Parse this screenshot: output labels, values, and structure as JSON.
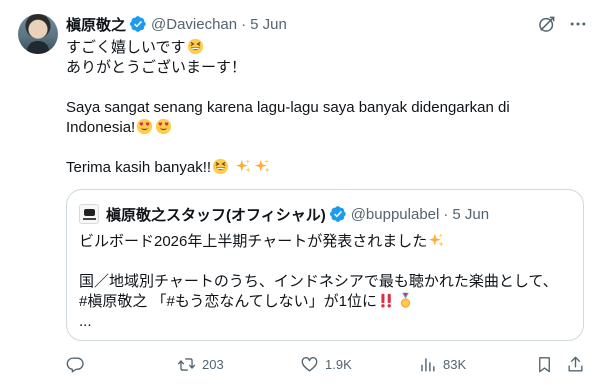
{
  "tweet": {
    "display_name": "槇原敬之",
    "handle": "@Daviechan",
    "separator": "·",
    "date": "5 Jun",
    "lines": {
      "l1": "すごく嬉しいです",
      "l2": "ありがとうございまーす！",
      "l3": "Saya sangat senang karena lagu-lagu saya banyak didengarkan di",
      "l4": "Indonesia!",
      "l5": "Terima kasih banyak!!"
    }
  },
  "quote": {
    "display_name": "槇原敬之スタッフ(オフィシャル)",
    "handle": "@buppulabel",
    "separator": "·",
    "date": "5 Jun",
    "lines": {
      "l1": "ビルボード2026年上半期チャートが発表されました",
      "l2": "国／地域別チャートのうち、インドネシアで最も聴かれた楽曲として、",
      "l3": "#槇原敬之 「#もう恋なんてしない」が1位に",
      "l4": "..."
    }
  },
  "actions": {
    "retweets": "203",
    "likes": "1.9K",
    "views": "83K"
  },
  "colors": {
    "verified": "#1d9bf0",
    "secondary_text": "#536471",
    "border": "#cfd9de"
  },
  "icons": [
    "verified-badge-icon",
    "grok-icon",
    "more-icon",
    "reply-icon",
    "retweet-icon",
    "like-icon",
    "views-icon",
    "bookmark-icon",
    "share-icon"
  ]
}
